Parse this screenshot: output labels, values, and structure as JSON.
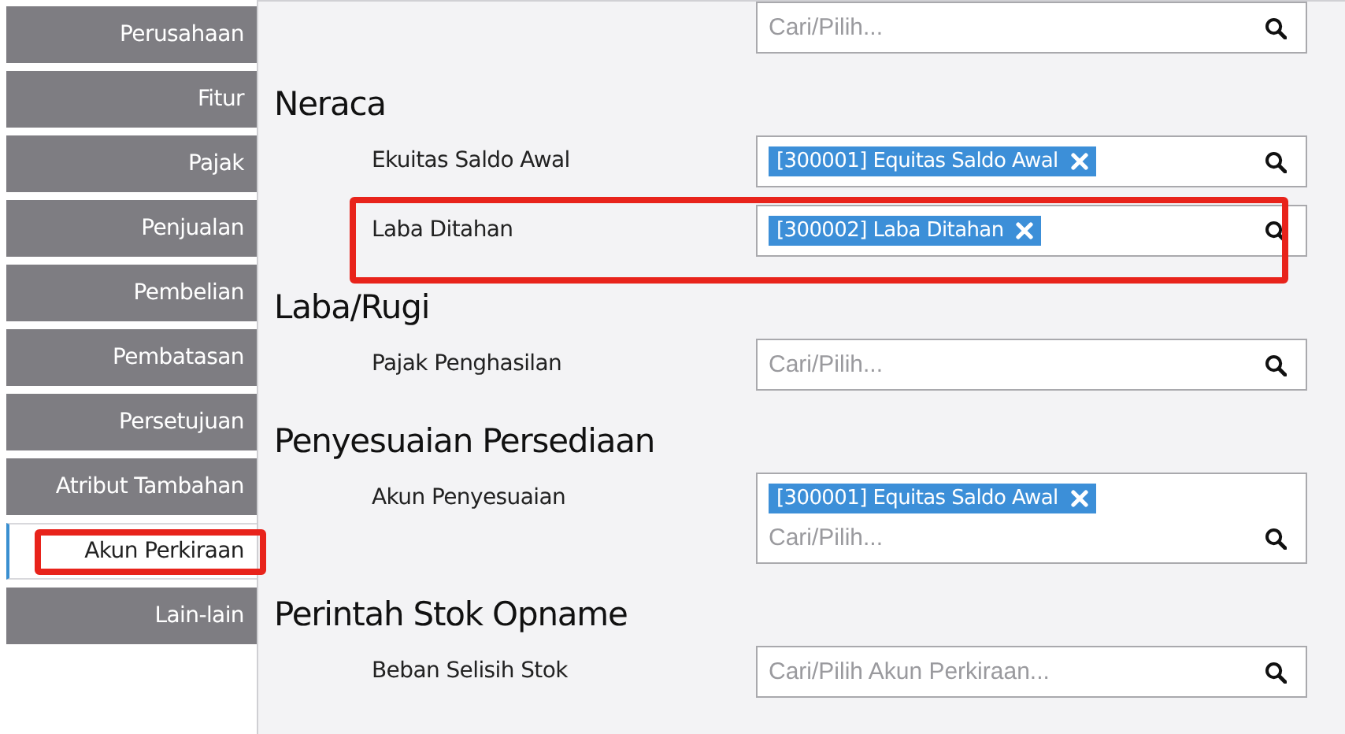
{
  "sidebar": {
    "items": [
      {
        "label": "Perusahaan",
        "selected": false,
        "highlighted": false
      },
      {
        "label": "Fitur",
        "selected": false,
        "highlighted": false
      },
      {
        "label": "Pajak",
        "selected": false,
        "highlighted": false
      },
      {
        "label": "Penjualan",
        "selected": false,
        "highlighted": false
      },
      {
        "label": "Pembelian",
        "selected": false,
        "highlighted": false
      },
      {
        "label": "Pembatasan",
        "selected": false,
        "highlighted": false
      },
      {
        "label": "Persetujuan",
        "selected": false,
        "highlighted": false
      },
      {
        "label": "Atribut Tambahan",
        "selected": false,
        "highlighted": false
      },
      {
        "label": "Akun Perkiraan",
        "selected": true,
        "highlighted": true
      },
      {
        "label": "Lain-lain",
        "selected": false,
        "highlighted": false
      }
    ]
  },
  "top_field": {
    "placeholder": "Cari/Pilih..."
  },
  "sections": [
    {
      "title": "Neraca",
      "rows": [
        {
          "label": "Ekuitas Saldo Awal",
          "highlighted": false,
          "tags": [
            "[300001] Equitas Saldo Awal"
          ]
        },
        {
          "label": "Laba Ditahan",
          "highlighted": true,
          "tags": [
            "[300002] Laba Ditahan"
          ]
        }
      ]
    },
    {
      "title": "Laba/Rugi",
      "rows": [
        {
          "label": "Pajak Penghasilan",
          "highlighted": false,
          "placeholder": "Cari/Pilih..."
        }
      ]
    },
    {
      "title": "Penyesuaian Persediaan",
      "rows": [
        {
          "label": "Akun Penyesuaian",
          "highlighted": false,
          "tags": [
            "[300001] Equitas Saldo Awal"
          ],
          "placeholder": "Cari/Pilih..."
        }
      ]
    },
    {
      "title": "Perintah Stok Opname",
      "rows": [
        {
          "label": "Beban Selisih Stok",
          "highlighted": false,
          "placeholder": "Cari/Pilih Akun Perkiraan..."
        }
      ]
    }
  ]
}
